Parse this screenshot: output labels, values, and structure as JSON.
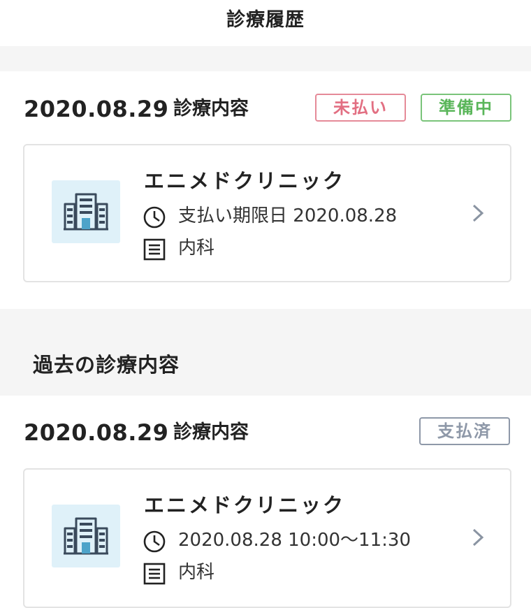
{
  "header": {
    "title": "診療履歴"
  },
  "current_record": {
    "date": "2020.08.29",
    "label": "診療内容",
    "badges": {
      "unpaid": "未払い",
      "preparing": "準備中"
    },
    "card": {
      "clinic_name": "エニメドクリニック",
      "payment_due_label": "支払い期限日",
      "payment_due_date": "2020.08.28",
      "department": "内科",
      "icons": {
        "clinic": "building-icon",
        "time": "clock-icon",
        "dept": "document-icon",
        "go": "chevron-right-icon"
      }
    }
  },
  "past_section": {
    "title": "過去の診療内容"
  },
  "past_records": [
    {
      "date": "2020.08.29",
      "label": "診療内容",
      "badge": "支払済",
      "card": {
        "clinic_name": "エニメドクリニック",
        "time_range": "2020.08.28 10:00〜11:30",
        "department": "内科"
      }
    }
  ],
  "colors": {
    "unpaid": "#e26f82",
    "preparing": "#5ab65a",
    "paid": "#8e98a8",
    "icon_bg": "#dff1f9",
    "band": "#f5f5f5"
  }
}
